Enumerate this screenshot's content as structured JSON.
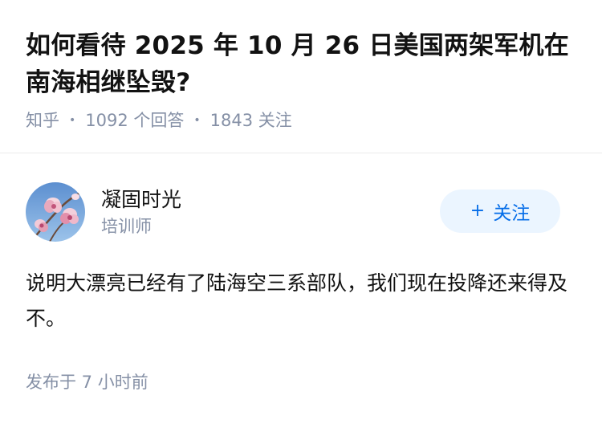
{
  "question": {
    "title": "如何看待 2025 年 10 月 26 日美国两架军机在南海相继坠毁?",
    "source": "知乎",
    "answers": "1092 个回答",
    "followers": "1843 关注"
  },
  "answer": {
    "author_name": "凝固时光",
    "author_title": "培训师",
    "follow_label": "关注",
    "follow_icon": "plus-icon",
    "content": "说明大漂亮已经有了陆海空三系部队，我们现在投降还来得及不。",
    "time": "发布于 7 小时前"
  },
  "colors": {
    "meta_gray": "#8590a6",
    "accent_blue": "#056de8",
    "button_bg": "#ebf5ff"
  }
}
